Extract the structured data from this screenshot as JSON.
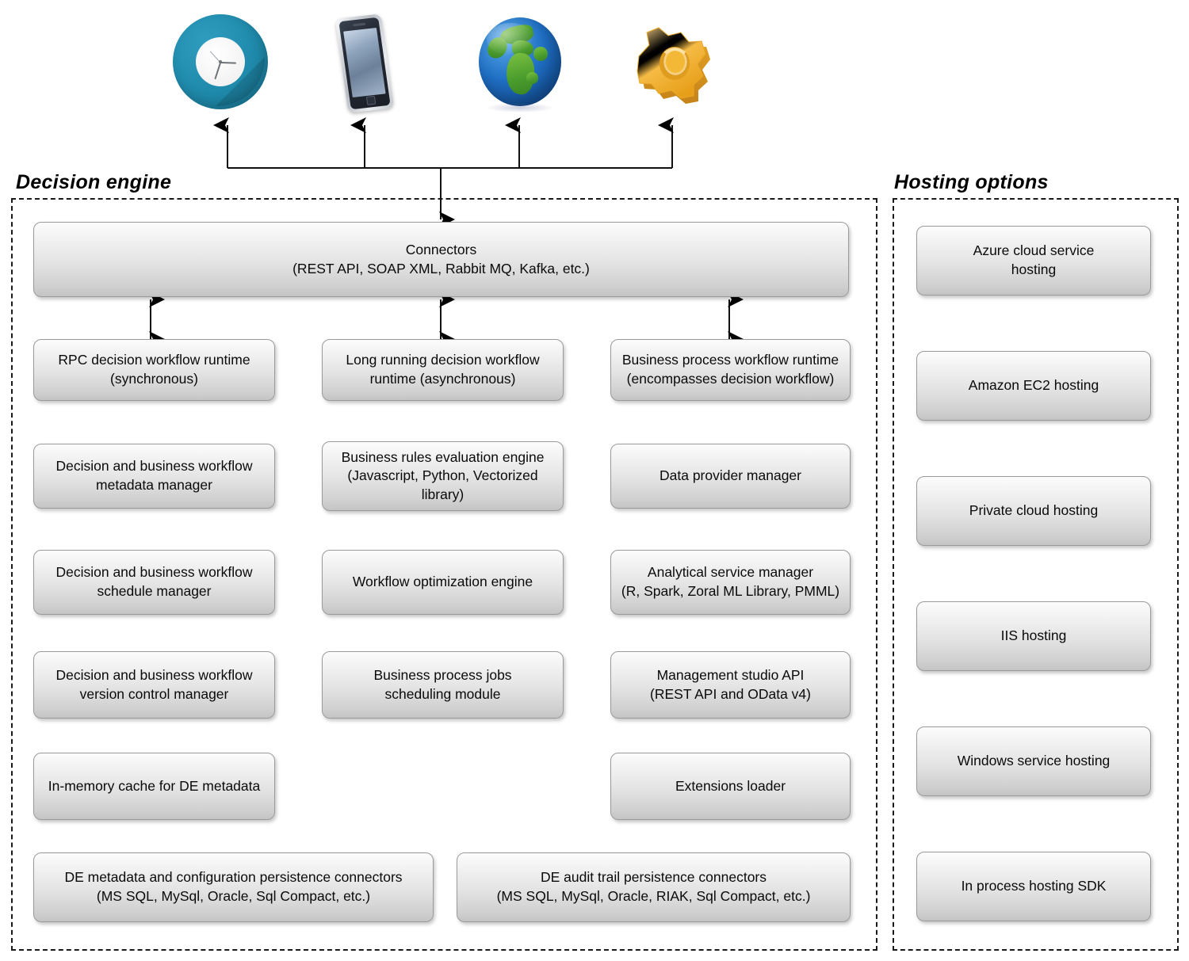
{
  "top_icons": [
    {
      "name": "clock-icon",
      "label": "clock",
      "color": "#1f8aab"
    },
    {
      "name": "mobile-phone-icon",
      "label": "mobile phone",
      "color": "#2b313b"
    },
    {
      "name": "globe-icon",
      "label": "globe",
      "color": "#1f6fc4"
    },
    {
      "name": "gear-icon",
      "label": "gear",
      "color": "#f5b731"
    }
  ],
  "panels": {
    "decision_engine": {
      "title": "Decision engine",
      "connectors": {
        "line1": "Connectors",
        "line2": "(REST API, SOAP XML, Rabbit MQ, Kafka, etc.)",
        "text": "Connectors\n(REST API, SOAP XML, Rabbit MQ, Kafka, etc.)"
      },
      "columns": [
        {
          "name": "left-column",
          "nodes": [
            {
              "text": "RPC decision workflow runtime\n(synchronous)"
            },
            {
              "text": "Decision and business workflow\nmetadata manager"
            },
            {
              "text": "Decision and business workflow\nschedule manager"
            },
            {
              "text": "Decision and business workflow\nversion control manager"
            },
            {
              "text": "In-memory cache for DE metadata"
            }
          ]
        },
        {
          "name": "middle-column",
          "nodes": [
            {
              "text": "Long running decision workflow\nruntime (asynchronous)"
            },
            {
              "text": "Business rules evaluation engine\n(Javascript, Python, Vectorized\nlibrary)"
            },
            {
              "text": "Workflow optimization engine"
            },
            {
              "text": "Business process jobs\nscheduling module"
            }
          ]
        },
        {
          "name": "right-column",
          "nodes": [
            {
              "text": "Business process workflow runtime\n(encompasses decision workflow)"
            },
            {
              "text": "Data provider manager"
            },
            {
              "text": "Analytical service manager\n(R, Spark, Zoral ML Library, PMML)"
            },
            {
              "text": "Management studio API\n(REST API and OData v4)"
            },
            {
              "text": "Extensions loader"
            }
          ]
        }
      ],
      "persistence": [
        {
          "text": "DE metadata and configuration persistence connectors\n(MS SQL, MySql, Oracle, Sql Compact, etc.)"
        },
        {
          "text": "DE audit trail persistence connectors\n(MS SQL, MySql, Oracle, RIAK, Sql Compact, etc.)"
        }
      ]
    },
    "hosting_options": {
      "title": "Hosting options",
      "nodes": [
        {
          "text": "Azure cloud service\nhosting"
        },
        {
          "text": "Amazon EC2 hosting"
        },
        {
          "text": "Private cloud hosting"
        },
        {
          "text": "IIS hosting"
        },
        {
          "text": "Windows service hosting"
        },
        {
          "text": "In process hosting SDK"
        }
      ]
    }
  }
}
